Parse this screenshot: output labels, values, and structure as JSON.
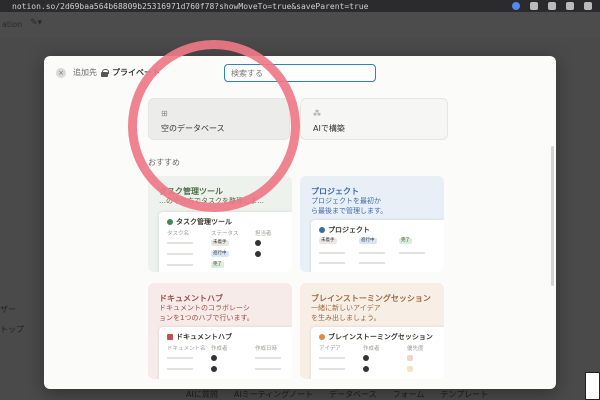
{
  "browser": {
    "url": "notion.so/2d69baa564b68809b25316971d760f78?showMoveTo=true&saveParent=true"
  },
  "background": {
    "top_left_label": "ation",
    "side_items": [
      "ザー",
      "トップ"
    ],
    "bottom_bar": [
      "AIに質問",
      "AIミーティングノート",
      "データベース",
      "フォーム",
      "テンプレート"
    ]
  },
  "modal": {
    "close_symbol": "×",
    "add_to_label": "追加先",
    "add_to_target": "プライベート",
    "search_placeholder": "検索する",
    "options": [
      {
        "icon": "table-icon",
        "glyph": "⊞",
        "label": "空のデータベース"
      },
      {
        "icon": "ai-icon",
        "glyph": "⁂",
        "label": "AIで構築"
      }
    ],
    "recommended_label": "おすすめ",
    "templates": [
      {
        "title": "タスク管理ツール",
        "desc": "…のやり方でタスクを整理しま…",
        "preview_title": "タスク管理ツール",
        "columns": [
          "タスク名",
          "ステータス",
          "担当者"
        ],
        "chips": [
          "未着手",
          "進行中",
          "完了"
        ],
        "color": "#4f6a4a"
      },
      {
        "title": "プロジェクト",
        "desc": "プロジェクトを最初か\nら最後まで管理します。",
        "preview_title": "プロジェクト",
        "chips": [
          "未着手",
          "進行中",
          "完了"
        ],
        "color": "#3f6aa5"
      },
      {
        "title": "ドキュメントハブ",
        "desc": "ドキュメントのコラボレーシ\nョンを1つのハブで行います。",
        "preview_title": "ドキュメントハブ",
        "columns": [
          "ドキュメント名",
          "作成者",
          "作成日時"
        ],
        "color": "#9a4f49"
      },
      {
        "title": "ブレインストーミングセッション",
        "desc": "一緒に新しいアイデア\nを生み出しましょう。",
        "preview_title": "ブレインストーミングセッション",
        "columns": [
          "アイデア",
          "作成者",
          "優先度"
        ],
        "color": "#9a6a3e"
      }
    ]
  },
  "colors": {
    "accent": "#2f80c9",
    "highlight_ring": "#ee7887",
    "chip_gray": "#e9e8e5",
    "chip_blue": "#d7e6f6",
    "chip_green": "#dbeddb"
  }
}
